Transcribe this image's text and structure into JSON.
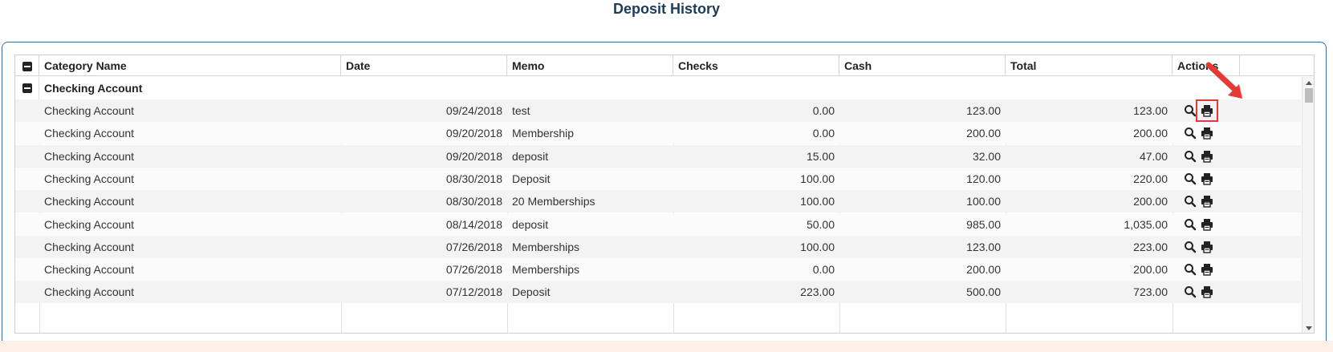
{
  "page": {
    "title": "Deposit History"
  },
  "grid": {
    "columns": {
      "category": "Category Name",
      "date": "Date",
      "memo": "Memo",
      "checks": "Checks",
      "cash": "Cash",
      "total": "Total",
      "actions": "Actions"
    },
    "group": {
      "label": "Checking Account"
    },
    "rows": [
      {
        "category": "Checking Account",
        "date": "09/24/2018",
        "memo": "test",
        "checks": "0.00",
        "cash": "123.00",
        "total": "123.00"
      },
      {
        "category": "Checking Account",
        "date": "09/20/2018",
        "memo": "Membership",
        "checks": "0.00",
        "cash": "200.00",
        "total": "200.00"
      },
      {
        "category": "Checking Account",
        "date": "09/20/2018",
        "memo": "deposit",
        "checks": "15.00",
        "cash": "32.00",
        "total": "47.00"
      },
      {
        "category": "Checking Account",
        "date": "08/30/2018",
        "memo": "Deposit",
        "checks": "100.00",
        "cash": "120.00",
        "total": "220.00"
      },
      {
        "category": "Checking Account",
        "date": "08/30/2018",
        "memo": "20 Memberships",
        "checks": "100.00",
        "cash": "100.00",
        "total": "200.00"
      },
      {
        "category": "Checking Account",
        "date": "08/14/2018",
        "memo": "deposit",
        "checks": "50.00",
        "cash": "985.00",
        "total": "1,035.00"
      },
      {
        "category": "Checking Account",
        "date": "07/26/2018",
        "memo": "Memberships",
        "checks": "100.00",
        "cash": "123.00",
        "total": "223.00"
      },
      {
        "category": "Checking Account",
        "date": "07/26/2018",
        "memo": "Memberships",
        "checks": "0.00",
        "cash": "200.00",
        "total": "200.00"
      },
      {
        "category": "Checking Account",
        "date": "07/12/2018",
        "memo": "Deposit",
        "checks": "223.00",
        "cash": "500.00",
        "total": "723.00"
      }
    ],
    "action_icons": [
      "search-icon",
      "print-icon"
    ]
  },
  "colors": {
    "title": "#1d3c5a",
    "panel_border": "#3d6b8f",
    "highlight": "#e53935",
    "row_odd": "#f3f3f3",
    "row_even": "#fbfbfb"
  }
}
